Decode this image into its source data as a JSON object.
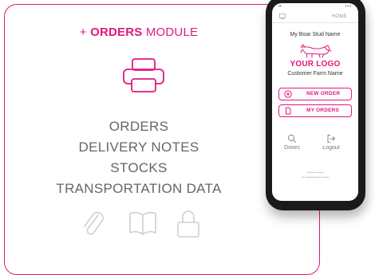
{
  "module": {
    "prefix": "+ ",
    "name": "ORDERS",
    "suffix": " MODULE",
    "icon": "printer-icon",
    "features": [
      "ORDERS",
      "DELIVERY NOTES",
      "STOCKS",
      "TRANSPORTATION DATA"
    ],
    "bottom_icons": [
      "paperclip-icon",
      "book-icon",
      "lock-icon"
    ],
    "accent_color": "#e0197d"
  },
  "phone": {
    "topbar": {
      "home_label": "HOME"
    },
    "stud_name": "My Boar Stud Name",
    "logo_text": "YOUR LOGO",
    "farm_name": "Customer Farm Name",
    "buttons": [
      {
        "label": "NEW ORDER",
        "icon": "plus-circle-icon"
      },
      {
        "label": "MY ORDERS",
        "icon": "document-icon"
      }
    ],
    "quick_actions": [
      {
        "label": "Doses",
        "icon": "search-icon"
      },
      {
        "label": "Logout",
        "icon": "logout-icon"
      }
    ]
  }
}
